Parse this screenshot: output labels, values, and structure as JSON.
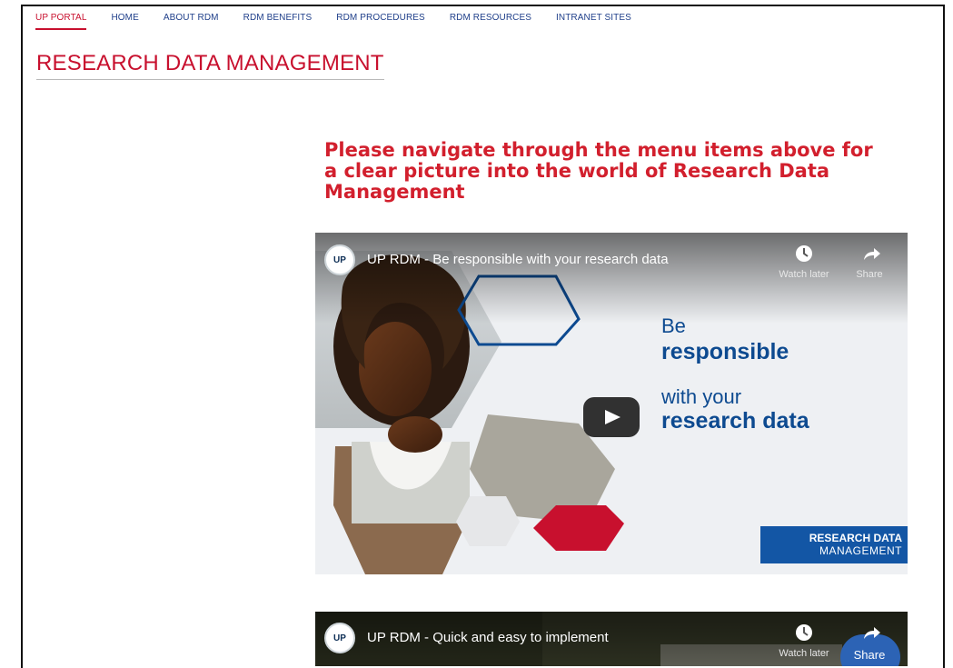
{
  "nav": {
    "items": [
      {
        "label": "UP PORTAL",
        "active": true
      },
      {
        "label": "HOME",
        "active": false
      },
      {
        "label": "ABOUT RDM",
        "active": false
      },
      {
        "label": "RDM BENEFITS",
        "active": false
      },
      {
        "label": "RDM PROCEDURES",
        "active": false
      },
      {
        "label": "RDM RESOURCES",
        "active": false
      },
      {
        "label": "INTRANET SITES",
        "active": false
      }
    ]
  },
  "page": {
    "title": "RESEARCH DATA MANAGEMENT",
    "lead": "Please navigate through the menu items above for a clear picture into the world of Research Data Management"
  },
  "videos": [
    {
      "channel_logo": "UP",
      "title": "UP RDM - Be responsible with your research data",
      "watch_later": "Watch later",
      "share": "Share",
      "overlay": {
        "l1": "Be",
        "l2": "responsible",
        "l3": "with your",
        "l4": "research data"
      },
      "badge": {
        "line1": "RESEARCH DATA",
        "line2": "MANAGEMENT"
      }
    },
    {
      "channel_logo": "UP",
      "title": "UP RDM - Quick and easy to implement",
      "watch_later": "Watch later",
      "share": "Share"
    }
  ],
  "colors": {
    "accent": "#c8102e",
    "nav": "#1f3f8a",
    "lead": "#d21f2d",
    "brand_blue": "#1356a5"
  },
  "icons": [
    "clock-icon",
    "share-arrow-icon",
    "play-icon"
  ]
}
